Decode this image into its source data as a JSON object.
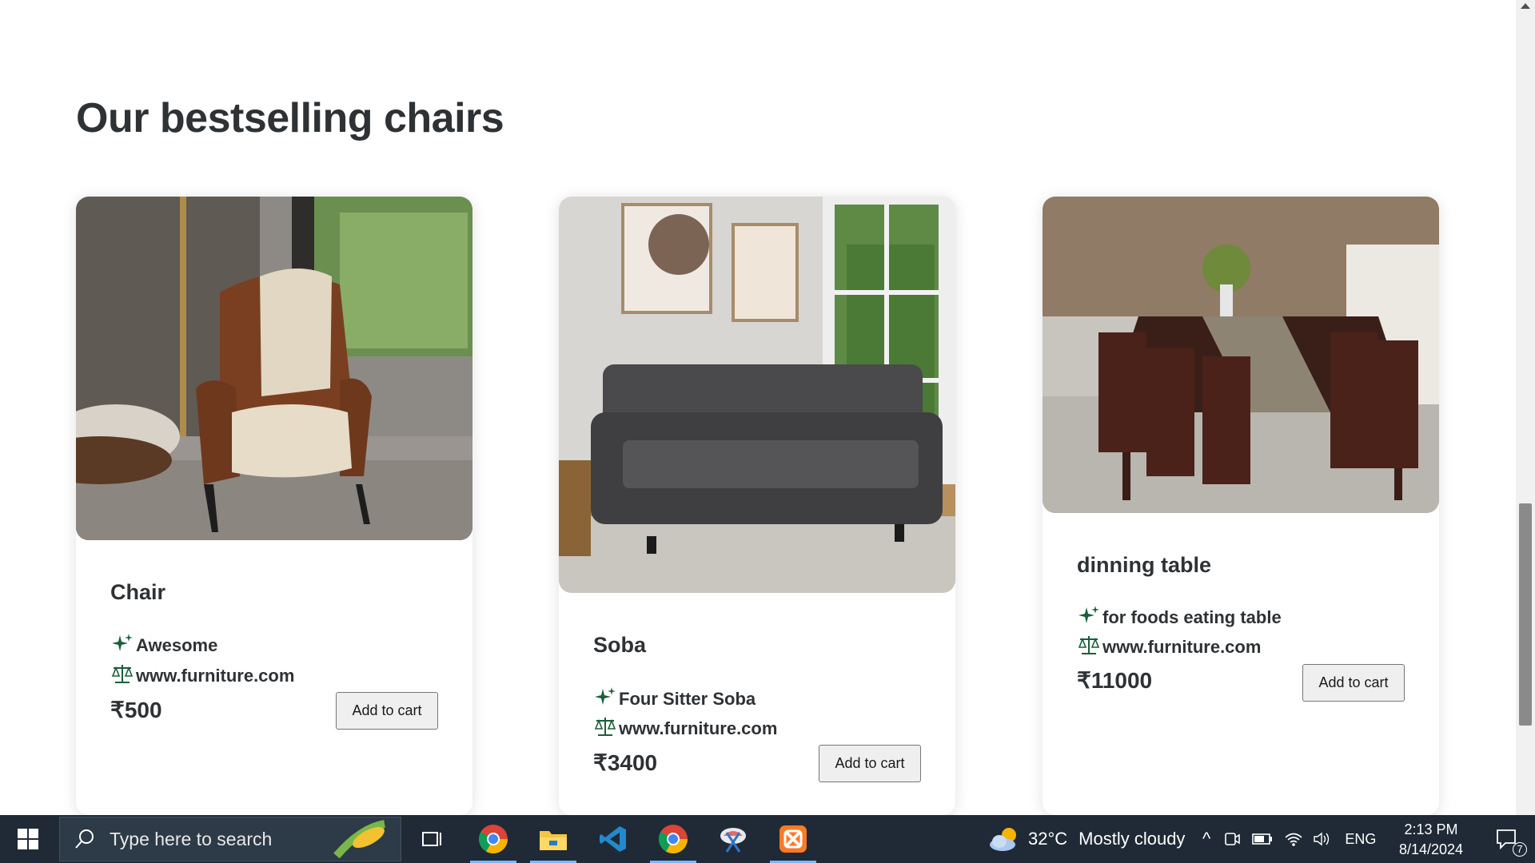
{
  "page": {
    "title": "Our bestselling chairs"
  },
  "products": [
    {
      "name": "Chair",
      "description": "Awesome",
      "site": "www.furniture.com",
      "price": "₹500",
      "button": "Add to cart",
      "image": "armchair-photo"
    },
    {
      "name": "Soba",
      "description": "Four Sitter Soba",
      "site": "www.furniture.com",
      "price": "₹3400",
      "button": "Add to cart",
      "image": "sofa-photo"
    },
    {
      "name": "dinning table",
      "description": "for foods eating table",
      "site": "www.furniture.com",
      "price": "₹11000",
      "button": "Add to cart",
      "image": "dining-table-photo"
    }
  ],
  "icons": {
    "description": "sparkles-icon",
    "site": "scale-icon"
  },
  "colors": {
    "icon_green": "#1b5e3b",
    "text": "#2f3235",
    "taskbar": "#1f2a36"
  },
  "taskbar": {
    "search_placeholder": "Type here to search",
    "weather_temp": "32°C",
    "weather_text": "Mostly cloudy",
    "language": "ENG",
    "time": "2:13 PM",
    "date": "8/14/2024",
    "notification_count": "7"
  }
}
